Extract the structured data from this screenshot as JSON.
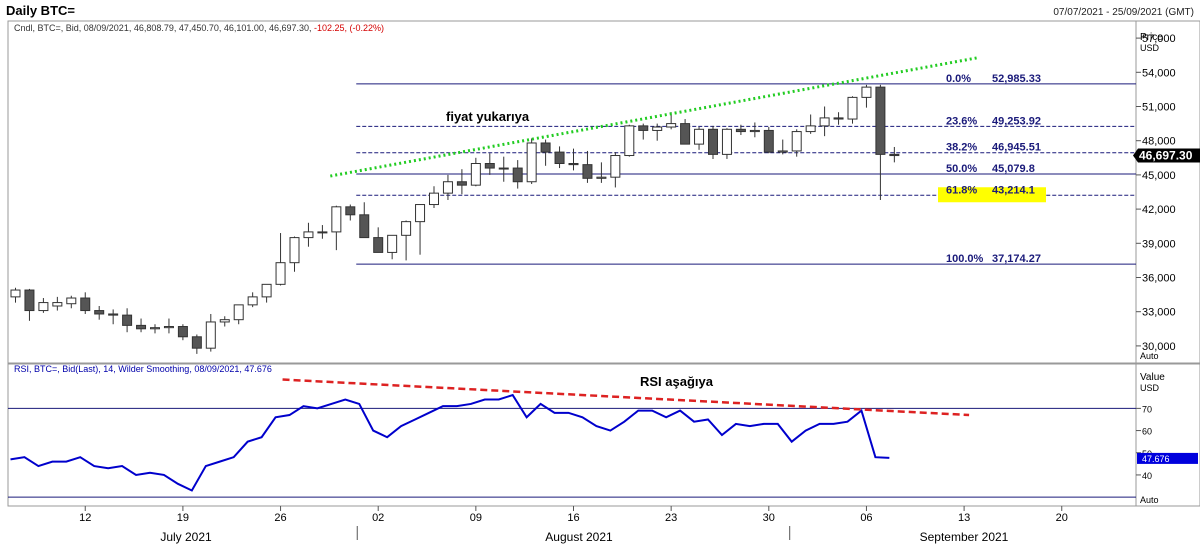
{
  "header": {
    "title": "Daily BTC=",
    "date_range": "07/07/2021 - 25/09/2021 (GMT)"
  },
  "price_panel": {
    "info_prefix": "Cndl, BTC=, Bid, 08/09/2021, 46,808.79, 47,450.70, 46,101.00, 46,697.30,",
    "info_change": "-102.25, (-0.22%)",
    "axis_title": "Price",
    "axis_unit": "USD",
    "last_price_label": "46,697.30",
    "auto_label": "Auto",
    "annotation": "fiyat yukarıya"
  },
  "rsi_panel": {
    "info": "RSI, BTC=, Bid(Last), 14, Wilder Smoothing, 08/09/2021, 47.676",
    "axis_title": "Value",
    "axis_unit": "USD",
    "last_value_label": "47.676",
    "auto_label": "Auto",
    "annotation": "RSI aşağıya"
  },
  "x_axis": {
    "day_ticks": [
      "12",
      "19",
      "26",
      "02",
      "09",
      "16",
      "23",
      "30",
      "06",
      "13",
      "20"
    ],
    "months": [
      "July 2021",
      "August 2021",
      "September 2021"
    ]
  },
  "colors": {
    "up": "#ffffff",
    "down": "#555555",
    "fib": "#1a1a7a",
    "rsi": "#0000cc",
    "trend_up": "#22cc22",
    "trend_down": "#dd2222",
    "highlight": "#ffff00"
  },
  "chart_data": [
    {
      "type": "candlestick",
      "title": "Daily BTC=",
      "ylabel": "Price USD",
      "ylim": [
        28500,
        58500
      ],
      "y_ticks": [
        "30,000",
        "33,000",
        "36,000",
        "39,000",
        "42,000",
        "45,000",
        "48,000",
        "51,000",
        "54,000",
        "57,000"
      ],
      "candles": [
        {
          "date": "2021-07-07",
          "o": 34300,
          "h": 35100,
          "l": 33800,
          "c": 34900
        },
        {
          "date": "2021-07-08",
          "o": 34900,
          "h": 35000,
          "l": 32200,
          "c": 33100
        },
        {
          "date": "2021-07-09",
          "o": 33100,
          "h": 34200,
          "l": 32900,
          "c": 33800
        },
        {
          "date": "2021-07-10",
          "o": 33500,
          "h": 34300,
          "l": 33100,
          "c": 33800
        },
        {
          "date": "2021-07-11",
          "o": 33700,
          "h": 34400,
          "l": 33300,
          "c": 34200
        },
        {
          "date": "2021-07-12",
          "o": 34200,
          "h": 34700,
          "l": 32800,
          "c": 33100
        },
        {
          "date": "2021-07-13",
          "o": 33100,
          "h": 33500,
          "l": 32300,
          "c": 32800
        },
        {
          "date": "2021-07-14",
          "o": 32800,
          "h": 33200,
          "l": 31900,
          "c": 32700
        },
        {
          "date": "2021-07-15",
          "o": 32700,
          "h": 33300,
          "l": 31200,
          "c": 31800
        },
        {
          "date": "2021-07-16",
          "o": 31800,
          "h": 32400,
          "l": 31200,
          "c": 31500
        },
        {
          "date": "2021-07-17",
          "o": 31500,
          "h": 31900,
          "l": 31100,
          "c": 31600
        },
        {
          "date": "2021-07-18",
          "o": 31600,
          "h": 32400,
          "l": 31100,
          "c": 31700
        },
        {
          "date": "2021-07-19",
          "o": 31700,
          "h": 31900,
          "l": 30500,
          "c": 30800
        },
        {
          "date": "2021-07-20",
          "o": 30800,
          "h": 31000,
          "l": 29300,
          "c": 29800
        },
        {
          "date": "2021-07-21",
          "o": 29800,
          "h": 32800,
          "l": 29500,
          "c": 32100
        },
        {
          "date": "2021-07-22",
          "o": 32100,
          "h": 32600,
          "l": 31700,
          "c": 32300
        },
        {
          "date": "2021-07-23",
          "o": 32300,
          "h": 33600,
          "l": 31900,
          "c": 33600
        },
        {
          "date": "2021-07-24",
          "o": 33600,
          "h": 34700,
          "l": 33400,
          "c": 34300
        },
        {
          "date": "2021-07-25",
          "o": 34300,
          "h": 35400,
          "l": 33800,
          "c": 35400
        },
        {
          "date": "2021-07-26",
          "o": 35400,
          "h": 39900,
          "l": 35300,
          "c": 37300
        },
        {
          "date": "2021-07-27",
          "o": 37300,
          "h": 39600,
          "l": 36500,
          "c": 39500
        },
        {
          "date": "2021-07-28",
          "o": 39500,
          "h": 40800,
          "l": 38700,
          "c": 40000
        },
        {
          "date": "2021-07-29",
          "o": 40000,
          "h": 40600,
          "l": 39400,
          "c": 40000
        },
        {
          "date": "2021-07-30",
          "o": 40000,
          "h": 42300,
          "l": 38400,
          "c": 42200
        },
        {
          "date": "2021-07-31",
          "o": 42200,
          "h": 42400,
          "l": 41000,
          "c": 41500
        },
        {
          "date": "2021-08-01",
          "o": 41500,
          "h": 42600,
          "l": 39500,
          "c": 39500
        },
        {
          "date": "2021-08-02",
          "o": 39500,
          "h": 40400,
          "l": 38800,
          "c": 38200
        },
        {
          "date": "2021-08-03",
          "o": 38200,
          "h": 39700,
          "l": 37600,
          "c": 39700
        },
        {
          "date": "2021-08-04",
          "o": 39700,
          "h": 41000,
          "l": 37500,
          "c": 40900
        },
        {
          "date": "2021-08-05",
          "o": 40900,
          "h": 42000,
          "l": 38000,
          "c": 42400
        },
        {
          "date": "2021-08-06",
          "o": 42400,
          "h": 44000,
          "l": 42100,
          "c": 43400
        },
        {
          "date": "2021-08-07",
          "o": 43400,
          "h": 45000,
          "l": 42800,
          "c": 44400
        },
        {
          "date": "2021-08-08",
          "o": 44400,
          "h": 45500,
          "l": 43300,
          "c": 44100
        },
        {
          "date": "2021-08-09",
          "o": 44100,
          "h": 46500,
          "l": 44000,
          "c": 46000
        },
        {
          "date": "2021-08-10",
          "o": 46000,
          "h": 46900,
          "l": 45000,
          "c": 45600
        },
        {
          "date": "2021-08-11",
          "o": 45600,
          "h": 46600,
          "l": 44400,
          "c": 45600
        },
        {
          "date": "2021-08-12",
          "o": 45600,
          "h": 46300,
          "l": 43800,
          "c": 44400
        },
        {
          "date": "2021-08-13",
          "o": 44400,
          "h": 48200,
          "l": 44200,
          "c": 47800
        },
        {
          "date": "2021-08-14",
          "o": 47800,
          "h": 48100,
          "l": 45800,
          "c": 47000
        },
        {
          "date": "2021-08-15",
          "o": 47000,
          "h": 47500,
          "l": 45600,
          "c": 46000
        },
        {
          "date": "2021-08-16",
          "o": 46000,
          "h": 47300,
          "l": 45400,
          "c": 45900
        },
        {
          "date": "2021-08-17",
          "o": 45900,
          "h": 47100,
          "l": 44300,
          "c": 44700
        },
        {
          "date": "2021-08-18",
          "o": 44700,
          "h": 46100,
          "l": 44300,
          "c": 44800
        },
        {
          "date": "2021-08-19",
          "o": 44800,
          "h": 47000,
          "l": 43900,
          "c": 46700
        },
        {
          "date": "2021-08-20",
          "o": 46700,
          "h": 49400,
          "l": 46600,
          "c": 49300
        },
        {
          "date": "2021-08-21",
          "o": 49300,
          "h": 49500,
          "l": 48100,
          "c": 48900
        },
        {
          "date": "2021-08-22",
          "o": 48900,
          "h": 49500,
          "l": 48000,
          "c": 49200
        },
        {
          "date": "2021-08-23",
          "o": 49200,
          "h": 50500,
          "l": 49000,
          "c": 49500
        },
        {
          "date": "2021-08-24",
          "o": 49500,
          "h": 49900,
          "l": 47700,
          "c": 47700
        },
        {
          "date": "2021-08-25",
          "o": 47700,
          "h": 49200,
          "l": 47200,
          "c": 49000
        },
        {
          "date": "2021-08-26",
          "o": 49000,
          "h": 49300,
          "l": 46400,
          "c": 46800
        },
        {
          "date": "2021-08-27",
          "o": 46800,
          "h": 49100,
          "l": 46400,
          "c": 49000
        },
        {
          "date": "2021-08-28",
          "o": 49000,
          "h": 49400,
          "l": 48500,
          "c": 48800
        },
        {
          "date": "2021-08-29",
          "o": 48800,
          "h": 49600,
          "l": 48300,
          "c": 48900
        },
        {
          "date": "2021-08-30",
          "o": 48900,
          "h": 49200,
          "l": 46900,
          "c": 47000
        },
        {
          "date": "2021-08-31",
          "o": 47000,
          "h": 48100,
          "l": 46800,
          "c": 47100
        },
        {
          "date": "2021-09-01",
          "o": 47100,
          "h": 49000,
          "l": 46600,
          "c": 48800
        },
        {
          "date": "2021-09-02",
          "o": 48800,
          "h": 50300,
          "l": 48600,
          "c": 49300
        },
        {
          "date": "2021-09-03",
          "o": 49300,
          "h": 51000,
          "l": 48400,
          "c": 50000
        },
        {
          "date": "2021-09-04",
          "o": 50000,
          "h": 50500,
          "l": 49400,
          "c": 49900
        },
        {
          "date": "2021-09-05",
          "o": 49900,
          "h": 51900,
          "l": 49500,
          "c": 51800
        },
        {
          "date": "2021-09-06",
          "o": 51800,
          "h": 52900,
          "l": 50900,
          "c": 52700
        },
        {
          "date": "2021-09-07",
          "o": 52700,
          "h": 52900,
          "l": 42800,
          "c": 46800
        },
        {
          "date": "2021-09-08",
          "o": 46800,
          "h": 47450,
          "l": 46101,
          "c": 46697
        }
      ],
      "fibonacci": [
        {
          "label": "0.0%",
          "value_label": "52,985.33",
          "value": 52985.33
        },
        {
          "label": "23.6%",
          "value_label": "49,253.92",
          "value": 49253.92
        },
        {
          "label": "38.2%",
          "value_label": "46,945.51",
          "value": 46945.51
        },
        {
          "label": "50.0%",
          "value_label": "45,079.8",
          "value": 45079.8
        },
        {
          "label": "61.8%",
          "value_label": "43,214.1",
          "value": 43214.1
        },
        {
          "label": "100.0%",
          "value_label": "37,174.27",
          "value": 37174.27
        }
      ],
      "trendline": {
        "from": {
          "date": "2021-07-31",
          "price": 44900
        },
        "to": {
          "date": "2021-09-13",
          "price": 55300
        }
      }
    },
    {
      "type": "line",
      "title": "RSI, BTC=, Bid(Last), 14, Wilder Smoothing",
      "ylabel": "Value USD",
      "ylim": [
        26,
        90
      ],
      "y_ticks": [
        "40",
        "50",
        "60",
        "70"
      ],
      "reference_lines": [
        70,
        30
      ],
      "series": [
        {
          "values": [
            47,
            48,
            44,
            46,
            46,
            48,
            44,
            43,
            44,
            40,
            41,
            40,
            36,
            33,
            44,
            46,
            48,
            55,
            57,
            66,
            67,
            71,
            70,
            72,
            74,
            72,
            60,
            57,
            62,
            65,
            68,
            71,
            71,
            72,
            74,
            74,
            76,
            66,
            72,
            68,
            68,
            66,
            62,
            60,
            64,
            69,
            69,
            66,
            69,
            64,
            65,
            58,
            63,
            62,
            63,
            63,
            55,
            60,
            63,
            63,
            64,
            69,
            48,
            47.676
          ]
        }
      ],
      "trendline": {
        "from": {
          "date": "2021-07-26",
          "value": 83
        },
        "to": {
          "date": "2021-09-13",
          "value": 67
        }
      }
    }
  ]
}
